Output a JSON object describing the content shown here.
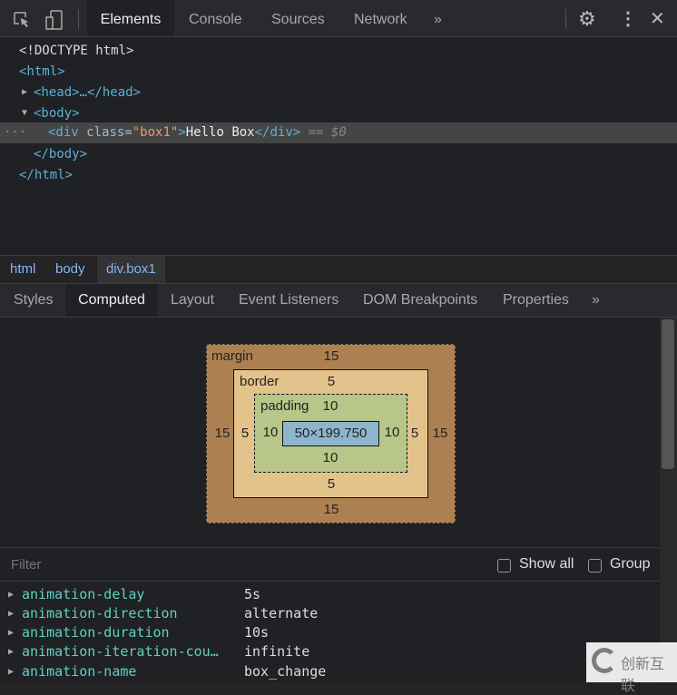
{
  "toolbar": {
    "tabs": [
      "Elements",
      "Console",
      "Sources",
      "Network"
    ],
    "more": "»",
    "active": "Elements"
  },
  "dom": {
    "doctype": "<!DOCTYPE html>",
    "html_open": "<html>",
    "head": "<head>…</head>",
    "body_open": "<body>",
    "div_open": "<div ",
    "div_attr": "class=",
    "div_val": "\"box1\"",
    "div_close_bracket": ">",
    "div_text": "Hello Box",
    "div_close": "</div>",
    "selected_marker": "== $0",
    "body_close": "</body>",
    "html_close": "</html>",
    "ellipsis": "···"
  },
  "breadcrumbs": [
    "html",
    "body",
    "div.box1"
  ],
  "panel_tabs": {
    "items": [
      "Styles",
      "Computed",
      "Layout",
      "Event Listeners",
      "DOM Breakpoints",
      "Properties"
    ],
    "more": "»",
    "active": "Computed"
  },
  "box_model": {
    "margin_label": "margin",
    "border_label": "border",
    "padding_label": "padding",
    "margin": {
      "top": "15",
      "right": "15",
      "bottom": "15",
      "left": "15"
    },
    "border": {
      "top": "5",
      "right": "5",
      "bottom": "5",
      "left": "5"
    },
    "padding": {
      "top": "10",
      "right": "10",
      "bottom": "10",
      "left": "10"
    },
    "content": "50×199.750",
    "colors": {
      "margin": "#ad8052",
      "border": "#e3c38b",
      "padding": "#b8c68a",
      "content": "#8db6cd"
    }
  },
  "filter": {
    "placeholder": "Filter",
    "show_all": "Show all",
    "group": "Group"
  },
  "properties": [
    {
      "name": "animation-delay",
      "value": "5s"
    },
    {
      "name": "animation-direction",
      "value": "alternate"
    },
    {
      "name": "animation-duration",
      "value": "10s"
    },
    {
      "name": "animation-iteration-cou…",
      "value": "infinite"
    },
    {
      "name": "animation-name",
      "value": "box_change"
    }
  ],
  "watermark": "创新互联"
}
